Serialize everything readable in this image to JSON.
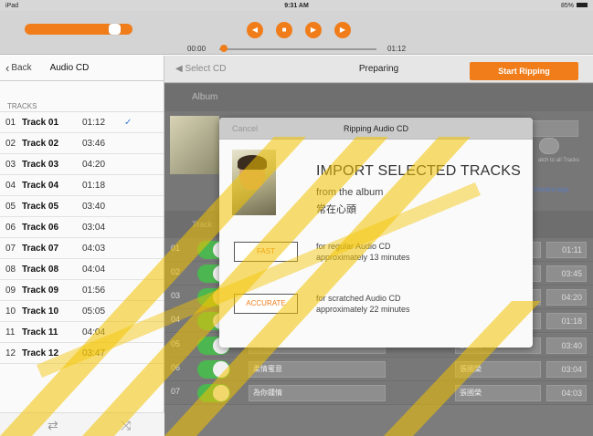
{
  "status": {
    "left": "iPad",
    "time": "9:31 AM",
    "battery": "85%"
  },
  "player": {
    "elapsed": "00:00",
    "duration": "01:12",
    "volume_fraction": 0.88,
    "seek_fraction": 0.01
  },
  "sidebar": {
    "back_label": "Back",
    "title": "Audio CD",
    "section_header": "TRACKS",
    "tracks": [
      {
        "num": "01",
        "title": "Track 01",
        "dur": "01:12",
        "checked": true
      },
      {
        "num": "02",
        "title": "Track 02",
        "dur": "03:46"
      },
      {
        "num": "03",
        "title": "Track 03",
        "dur": "04:20"
      },
      {
        "num": "04",
        "title": "Track 04",
        "dur": "01:18"
      },
      {
        "num": "05",
        "title": "Track 05",
        "dur": "03:40"
      },
      {
        "num": "06",
        "title": "Track 06",
        "dur": "03:04"
      },
      {
        "num": "07",
        "title": "Track 07",
        "dur": "04:03"
      },
      {
        "num": "08",
        "title": "Track 08",
        "dur": "04:04"
      },
      {
        "num": "09",
        "title": "Track 09",
        "dur": "01:56"
      },
      {
        "num": "10",
        "title": "Track 10",
        "dur": "05:05"
      },
      {
        "num": "11",
        "title": "Track 11",
        "dur": "04:04"
      },
      {
        "num": "12",
        "title": "Track 12",
        "dur": "03:47"
      }
    ]
  },
  "main": {
    "select_cd_label": "Select CD",
    "status_title": "Preparing",
    "start_button": "Start Ripping",
    "album_header": "Album",
    "tracks_header": "Track",
    "apply_all_label": "atch to all Tracks",
    "orchestra_label": "rchestra tags",
    "rows": [
      {
        "num": "01",
        "title": "",
        "artist": "",
        "dur": "01:11"
      },
      {
        "num": "02",
        "title": "",
        "artist": "",
        "dur": "03:45"
      },
      {
        "num": "03",
        "title": "",
        "artist": "",
        "dur": "04:20"
      },
      {
        "num": "04",
        "title": "",
        "artist": "",
        "dur": "01:18"
      },
      {
        "num": "05",
        "title": "一片痴",
        "artist": "張國榮",
        "dur": "03:40"
      },
      {
        "num": "06",
        "title": "柔情蜜意",
        "artist": "張國榮",
        "dur": "03:04"
      },
      {
        "num": "07",
        "title": "為你鍾情",
        "artist": "張國榮",
        "dur": "04:03"
      }
    ]
  },
  "modal": {
    "cancel_label": "Cancel",
    "title": "Ripping Audio CD",
    "heading": "IMPORT SELECTED TRACKS",
    "from_label": "from the album",
    "album_name": "常在心頭",
    "options": [
      {
        "button": "FAST",
        "line1": "for regular Audio CD",
        "line2": "approximately 13 minutes"
      },
      {
        "button": "ACCURATE",
        "line1": "for scratched Audio CD",
        "line2": "approximately 22 minutes"
      }
    ]
  },
  "colors": {
    "accent": "#f07d1a",
    "toggle_on": "#4cb650",
    "link_blue": "#5b7bc6",
    "checkmark": "#3a7bd5"
  },
  "icons": {
    "repeat": "repeat-icon",
    "shuffle": "shuffle-icon",
    "rewind": "rewind-icon",
    "stop": "stop-icon",
    "play": "play-icon",
    "forward": "fast-forward-icon"
  }
}
